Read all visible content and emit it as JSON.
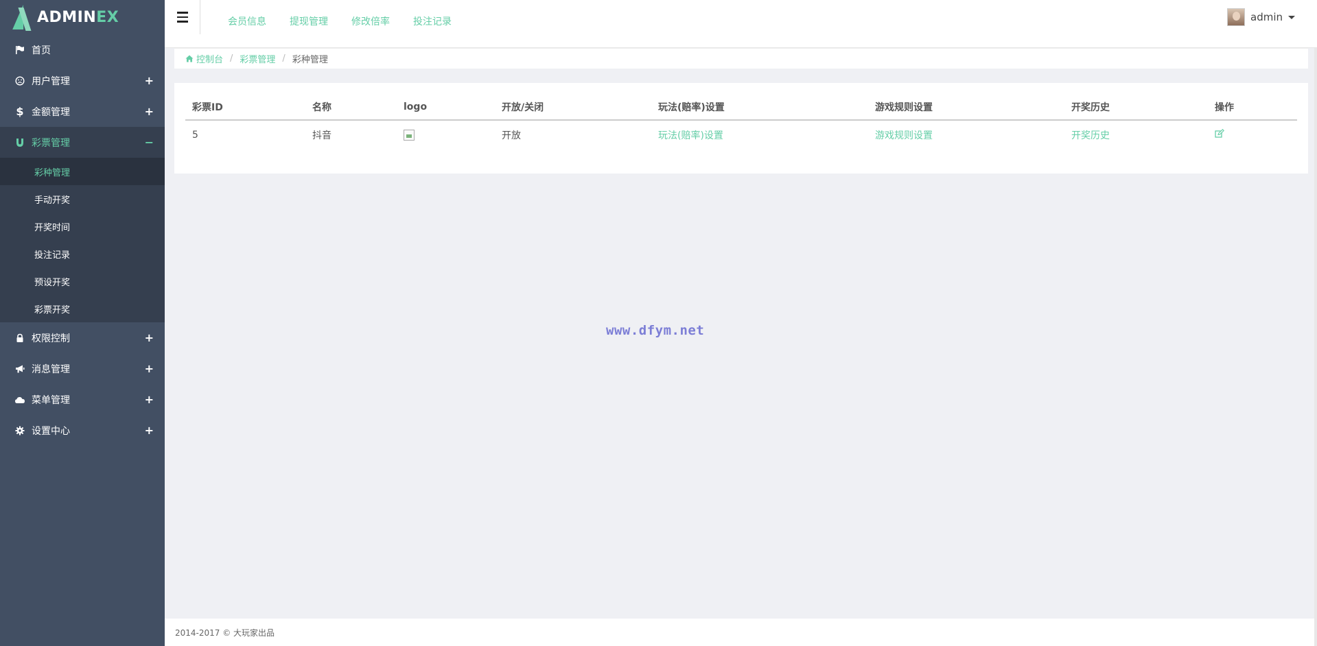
{
  "brand": {
    "prefix": "ADMIN",
    "suffix": "EX"
  },
  "sidebar": {
    "items": [
      {
        "label": "首页",
        "icon": "flag-icon"
      },
      {
        "label": "用户管理",
        "icon": "smile-icon",
        "toggle": "+"
      },
      {
        "label": "金额管理",
        "icon": "dollar-icon",
        "toggle": "+"
      },
      {
        "label": "彩票管理",
        "icon": "magnet-icon",
        "toggle": "−",
        "expanded": true,
        "children": [
          {
            "label": "彩种管理",
            "active": true
          },
          {
            "label": "手动开奖"
          },
          {
            "label": "开奖时间"
          },
          {
            "label": "投注记录"
          },
          {
            "label": "预设开奖"
          },
          {
            "label": "彩票开奖"
          }
        ]
      },
      {
        "label": "权限控制",
        "icon": "lock-icon",
        "toggle": "+"
      },
      {
        "label": "消息管理",
        "icon": "bullhorn-icon",
        "toggle": "+"
      },
      {
        "label": "菜单管理",
        "icon": "cloud-icon",
        "toggle": "+"
      },
      {
        "label": "设置中心",
        "icon": "gear-icon",
        "toggle": "+"
      }
    ]
  },
  "header": {
    "links": [
      "会员信息",
      "提现管理",
      "修改倍率",
      "投注记录"
    ],
    "user": "admin"
  },
  "breadcrumb": {
    "home": "控制台",
    "parent": "彩票管理",
    "current": "彩种管理"
  },
  "table": {
    "columns": [
      "彩票ID",
      "名称",
      "logo",
      "开放/关闭",
      "玩法(赔率)设置",
      "游戏规则设置",
      "开奖历史",
      "操作"
    ],
    "rows": [
      {
        "id": "5",
        "name": "抖音",
        "status": "开放",
        "odds": "玩法(赔率)设置",
        "rules": "游戏规则设置",
        "history": "开奖历史"
      }
    ]
  },
  "watermark": "www.dfym.net",
  "footer": "2014-2017 © 大玩家出品",
  "colors": {
    "accent": "#65cea7",
    "sidebar": "#424f63",
    "sidebar_active": "#353f4f"
  }
}
